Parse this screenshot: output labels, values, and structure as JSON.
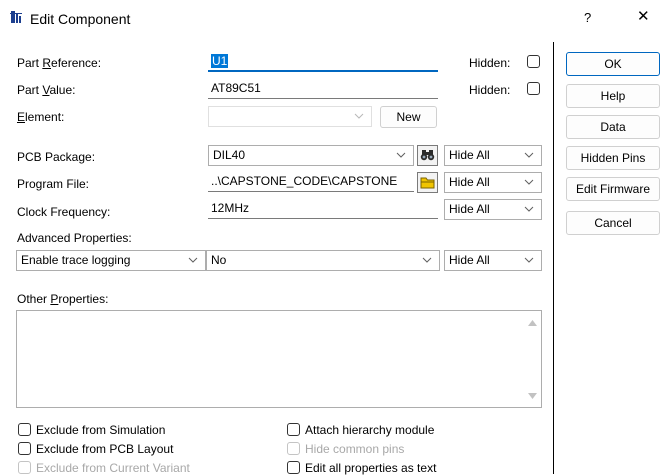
{
  "window": {
    "title": "Edit Component",
    "help_glyph": "?",
    "close_glyph": "✕"
  },
  "fields": {
    "part_reference": {
      "label_pre": "Part ",
      "label_ul": "R",
      "label_post": "eference:",
      "value": "U1",
      "hidden_label": "Hidden:"
    },
    "part_value": {
      "label_pre": "Part ",
      "label_ul": "V",
      "label_post": "alue:",
      "value": "AT89C51",
      "hidden_label": "Hidden:"
    },
    "element": {
      "label_pre": "",
      "label_ul": "E",
      "label_post": "lement:",
      "value": "",
      "new_label": "New"
    },
    "pcb_package": {
      "label": "PCB Package:",
      "value": "DIL40",
      "visibility": "Hide All"
    },
    "program_file": {
      "label": "Program File:",
      "value": "..\\CAPSTONE_CODE\\CAPSTONE",
      "visibility": "Hide All"
    },
    "clock_frequency": {
      "label": "Clock Frequency:",
      "value": "12MHz",
      "visibility": "Hide All"
    },
    "advanced": {
      "label": "Advanced Properties:",
      "property": "Enable trace logging",
      "value": "No",
      "visibility": "Hide All"
    },
    "other": {
      "label_pre": "Other ",
      "label_ul": "P",
      "label_post": "roperties:",
      "text": ""
    }
  },
  "buttons": {
    "ok": "OK",
    "help": "Help",
    "data": "Data",
    "hidden_pins": "Hidden Pins",
    "edit_firmware": "Edit Firmware",
    "cancel": "Cancel"
  },
  "checkboxes": {
    "exclude_sim": "Exclude from Simulation",
    "exclude_pcb": "Exclude from PCB Layout",
    "exclude_variant": "Exclude from Current Variant",
    "attach_hierarchy": "Attach hierarchy module",
    "hide_common_pins": "Hide common pins",
    "edit_all_text": "Edit all properties as text"
  },
  "colors": {
    "accent": "#0078d7",
    "folder": "#f0c400"
  }
}
